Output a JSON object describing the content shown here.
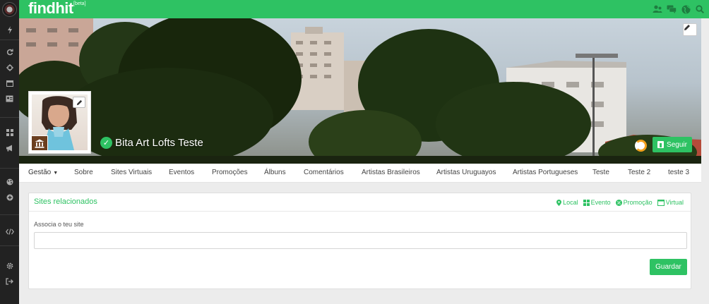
{
  "app": {
    "logo": "findhit",
    "beta": "[beta]"
  },
  "topbar_icons": [
    "users-icon",
    "chat-icon",
    "globe-icon",
    "search-icon"
  ],
  "sidebar_icons": [
    "bolt-icon",
    "refresh-icon",
    "crosshair-icon",
    "calendar-icon",
    "contact-card-icon",
    "grid-icon",
    "megaphone-icon",
    "palette-icon",
    "plus-circle-icon",
    "code-icon",
    "gear-icon",
    "logout-icon"
  ],
  "profile": {
    "name": "Bita Art Lofts Teste",
    "follow_label": "Seguir"
  },
  "tabs": [
    {
      "label": "Gestão",
      "caret": "▼"
    },
    {
      "label": "Sobre"
    },
    {
      "label": "Sites Virtuais"
    },
    {
      "label": "Eventos"
    },
    {
      "label": "Promoções"
    },
    {
      "label": "Álbuns"
    },
    {
      "label": "Comentários"
    },
    {
      "label": "Artistas Brasileiros"
    },
    {
      "label": "Artistas Uruguayos"
    },
    {
      "label": "Artistas Portugueses"
    },
    {
      "label": "Teste"
    },
    {
      "label": "Teste 2"
    },
    {
      "label": "teste 3"
    }
  ],
  "panel": {
    "title": "Sites relacionados",
    "links": {
      "local": "Local",
      "evento": "Evento",
      "promocao": "Promoção",
      "virtual": "Virtual"
    },
    "assoc_label": "Associa o teu site",
    "assoc_value": "",
    "save_label": "Guardar"
  },
  "colors": {
    "accent": "#2ec263",
    "sidebar": "#222222",
    "badge": "#6b3f1f",
    "spinner": "#f2a11d"
  }
}
